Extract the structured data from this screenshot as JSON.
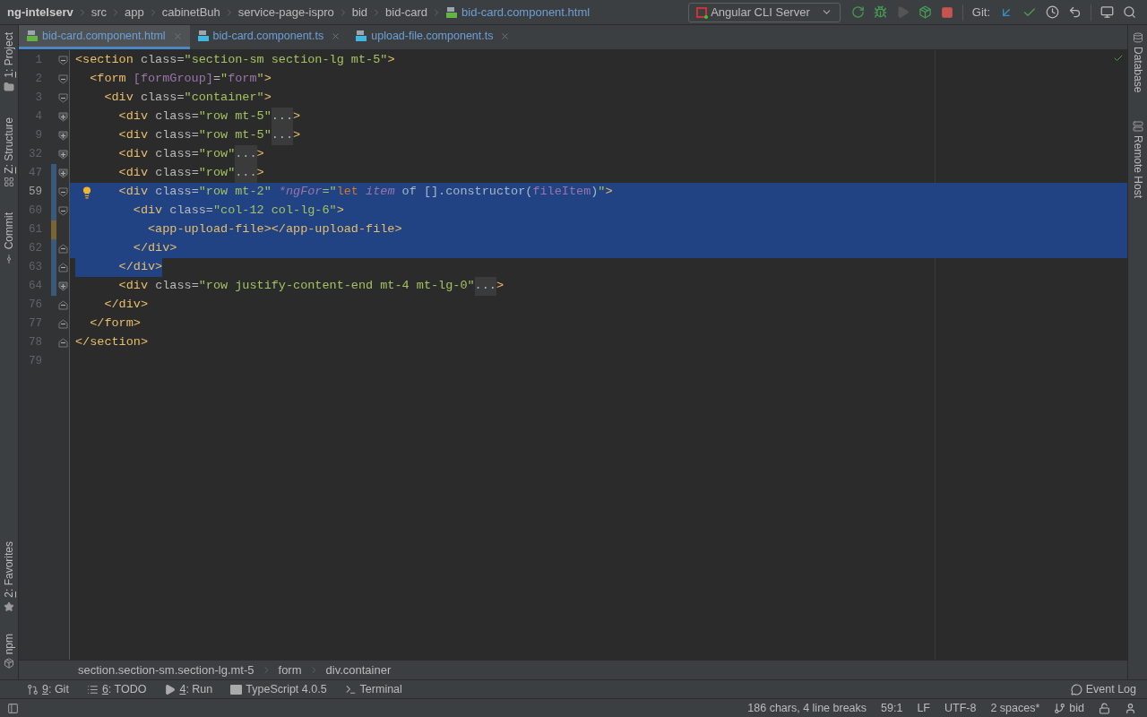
{
  "navbar": {
    "breadcrumbs": [
      "ng-intelserv",
      "src",
      "app",
      "cabinetBuh",
      "service-page-ispro",
      "bid",
      "bid-card",
      "bid-card.component.html"
    ],
    "run_config": "Angular CLI Server",
    "git_label": "Git:"
  },
  "tabs": [
    {
      "label": "bid-card.component.html",
      "kind": "html",
      "selected": true
    },
    {
      "label": "bid-card.component.ts",
      "kind": "ts",
      "selected": false
    },
    {
      "label": "upload-file.component.ts",
      "kind": "ts",
      "selected": false
    }
  ],
  "left_stripe": [
    {
      "mnemonic": "1",
      "label": ": Project"
    },
    {
      "mnemonic": "Z",
      "label": ": Structure"
    },
    {
      "label": "Commit"
    },
    {
      "mnemonic": "2",
      "label": ": Favorites"
    },
    {
      "label": "npm"
    }
  ],
  "right_stripe": [
    {
      "label": "Database"
    },
    {
      "label": "Remote Host"
    }
  ],
  "editor": {
    "lines": [
      {
        "number": "1",
        "fold": {
          "collapsed": false,
          "end": false
        },
        "selected": false,
        "current": false,
        "tokens": [
          {
            "kind": "tag",
            "text": "<section "
          },
          {
            "kind": "attr",
            "text": "class="
          },
          {
            "kind": "value",
            "text": "\"section-sm section-lg mt-5\""
          },
          {
            "kind": "tag",
            "text": ">"
          }
        ]
      },
      {
        "number": "2",
        "fold": {
          "collapsed": false,
          "end": false
        },
        "selected": false,
        "current": false,
        "tokens": [
          {
            "kind": "tag",
            "text": "  <form "
          },
          {
            "kind": "binding",
            "text": "[formGroup]"
          },
          {
            "kind": "attr",
            "text": "="
          },
          {
            "kind": "value",
            "text": "\""
          },
          {
            "kind": "binding",
            "text": "form"
          },
          {
            "kind": "value",
            "text": "\""
          },
          {
            "kind": "tag",
            "text": ">"
          }
        ]
      },
      {
        "number": "3",
        "fold": {
          "collapsed": false,
          "end": false
        },
        "selected": false,
        "current": false,
        "tokens": [
          {
            "kind": "tag",
            "text": "    <div "
          },
          {
            "kind": "attr",
            "text": "class="
          },
          {
            "kind": "value",
            "text": "\"container\""
          },
          {
            "kind": "tag",
            "text": ">"
          }
        ]
      },
      {
        "number": "4",
        "fold": {
          "collapsed": true,
          "end": false
        },
        "selected": false,
        "current": false,
        "tokens": [
          {
            "kind": "tag",
            "text": "      <div "
          },
          {
            "kind": "attr",
            "text": "class="
          },
          {
            "kind": "value",
            "text": "\"row mt-5\""
          },
          {
            "kind": "folded",
            "text": "..."
          },
          {
            "kind": "tag",
            "text": ">"
          }
        ]
      },
      {
        "number": "9",
        "fold": {
          "collapsed": true,
          "end": false
        },
        "selected": false,
        "current": false,
        "tokens": [
          {
            "kind": "tag",
            "text": "      <div "
          },
          {
            "kind": "attr",
            "text": "class="
          },
          {
            "kind": "value",
            "text": "\"row mt-5\""
          },
          {
            "kind": "folded",
            "text": "..."
          },
          {
            "kind": "tag",
            "text": ">"
          }
        ]
      },
      {
        "number": "32",
        "fold": {
          "collapsed": true,
          "end": false
        },
        "selected": false,
        "current": false,
        "tokens": [
          {
            "kind": "tag",
            "text": "      <div "
          },
          {
            "kind": "attr",
            "text": "class="
          },
          {
            "kind": "value",
            "text": "\"row\""
          },
          {
            "kind": "folded",
            "text": "..."
          },
          {
            "kind": "tag",
            "text": ">"
          }
        ]
      },
      {
        "number": "47",
        "fold": {
          "collapsed": true,
          "end": false
        },
        "change": {
          "modified": false
        },
        "selected": false,
        "current": false,
        "tokens": [
          {
            "kind": "tag",
            "text": "      <div "
          },
          {
            "kind": "attr",
            "text": "class="
          },
          {
            "kind": "value",
            "text": "\"row\""
          },
          {
            "kind": "folded",
            "text": "..."
          },
          {
            "kind": "tag",
            "text": ">"
          }
        ]
      },
      {
        "number": "59",
        "fold": {
          "collapsed": false,
          "end": false
        },
        "change": {
          "modified": false
        },
        "selected": true,
        "selection_partial": false,
        "current": true,
        "tokens": [
          {
            "kind": "tag",
            "text": "      <div "
          },
          {
            "kind": "attr",
            "text": "class="
          },
          {
            "kind": "value",
            "text": "\"row mt-2\" "
          },
          {
            "kind": "directive",
            "text": "*ngFor"
          },
          {
            "kind": "value",
            "text": "=\""
          },
          {
            "kind": "keyword",
            "text": "let "
          },
          {
            "kind": "directive",
            "text": "item"
          },
          {
            "kind": "plain",
            "text": " of [].constructor("
          },
          {
            "kind": "binding",
            "text": "fileItem"
          },
          {
            "kind": "plain",
            "text": ")"
          },
          {
            "kind": "value",
            "text": "\""
          },
          {
            "kind": "tag",
            "text": ">"
          }
        ]
      },
      {
        "number": "60",
        "fold": {
          "collapsed": false,
          "end": false
        },
        "change": {
          "modified": false
        },
        "selected": true,
        "selection_partial": false,
        "current": false,
        "tokens": [
          {
            "kind": "tag",
            "text": "        <div "
          },
          {
            "kind": "attr",
            "text": "class="
          },
          {
            "kind": "value",
            "text": "\"col-12 col-lg-6\""
          },
          {
            "kind": "tag",
            "text": ">"
          }
        ]
      },
      {
        "number": "61",
        "change": {
          "modified": true
        },
        "selected": true,
        "selection_partial": false,
        "current": false,
        "tokens": [
          {
            "kind": "tag",
            "text": "          <app-upload-file></app-upload-file>"
          }
        ]
      },
      {
        "number": "62",
        "fold": {
          "collapsed": false,
          "end": true
        },
        "change": {
          "modified": false
        },
        "selected": true,
        "selection_partial": false,
        "current": false,
        "tokens": [
          {
            "kind": "tag",
            "text": "        </div>"
          }
        ]
      },
      {
        "number": "63",
        "fold": {
          "collapsed": false,
          "end": true
        },
        "change": {
          "modified": false
        },
        "selected": true,
        "selection_partial": true,
        "current": false,
        "tokens": [
          {
            "kind": "tag",
            "text": "      </div>"
          }
        ]
      },
      {
        "number": "64",
        "fold": {
          "collapsed": true,
          "end": false
        },
        "change": {
          "modified": false
        },
        "selected": false,
        "current": false,
        "tokens": [
          {
            "kind": "tag",
            "text": "      <div "
          },
          {
            "kind": "attr",
            "text": "class="
          },
          {
            "kind": "value",
            "text": "\"row justify-content-end mt-4 mt-lg-0\""
          },
          {
            "kind": "folded",
            "text": "..."
          },
          {
            "kind": "tag",
            "text": ">"
          }
        ]
      },
      {
        "number": "76",
        "fold": {
          "collapsed": false,
          "end": true
        },
        "selected": false,
        "current": false,
        "tokens": [
          {
            "kind": "tag",
            "text": "    </div>"
          }
        ]
      },
      {
        "number": "77",
        "fold": {
          "collapsed": false,
          "end": true
        },
        "selected": false,
        "current": false,
        "tokens": [
          {
            "kind": "tag",
            "text": "  </form>"
          }
        ]
      },
      {
        "number": "78",
        "fold": {
          "collapsed": false,
          "end": true
        },
        "selected": false,
        "current": false,
        "tokens": [
          {
            "kind": "tag",
            "text": "</section>"
          }
        ]
      },
      {
        "number": "79",
        "selected": false,
        "current": false
      }
    ],
    "breadcrumbs": [
      "section.section-sm.section-lg.mt-5",
      "form",
      "div.container"
    ]
  },
  "tool_windows": [
    {
      "mnemonic": "9",
      "label": ": Git"
    },
    {
      "mnemonic": "6",
      "label": ": TODO"
    },
    {
      "mnemonic": "4",
      "label": ": Run"
    },
    {
      "label": "TypeScript 4.0.5"
    },
    {
      "label": "Terminal"
    }
  ],
  "event_log": "Event Log",
  "status_bar": [
    "186 chars, 4 line breaks",
    "59:1",
    "LF",
    "UTF-8",
    "2 spaces*"
  ],
  "branch": "bid"
}
